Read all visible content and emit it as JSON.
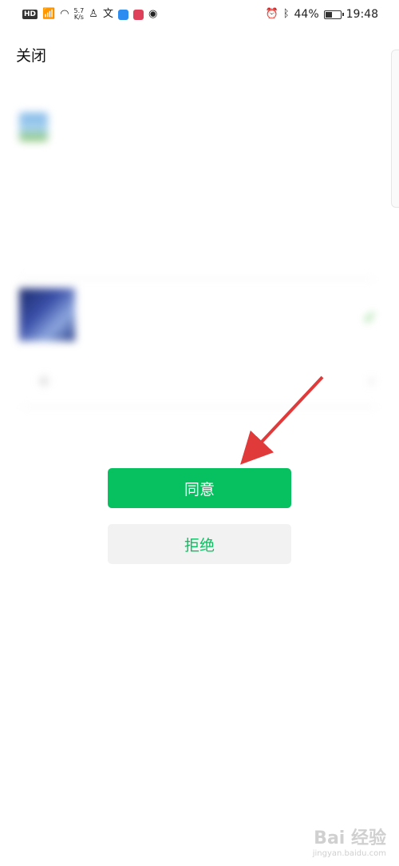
{
  "status_bar": {
    "hd": "HD",
    "signal": "4G",
    "speed_value": "5.7",
    "speed_unit": "K/s",
    "battery": "44%",
    "time": "19:48",
    "battery_level": 0.44
  },
  "nav": {
    "close_label": "关闭"
  },
  "auth": {
    "app_name": "",
    "headline": "",
    "note": "",
    "profile_name": "",
    "profile_sub": "",
    "other_option": ""
  },
  "actions": {
    "agree_label": "同意",
    "decline_label": "拒绝"
  },
  "watermark": {
    "main": "Bai 经验",
    "sub": "jingyan.baidu.com"
  },
  "colors": {
    "accent_green": "#07c160",
    "arrow_red": "#e03a3a"
  }
}
